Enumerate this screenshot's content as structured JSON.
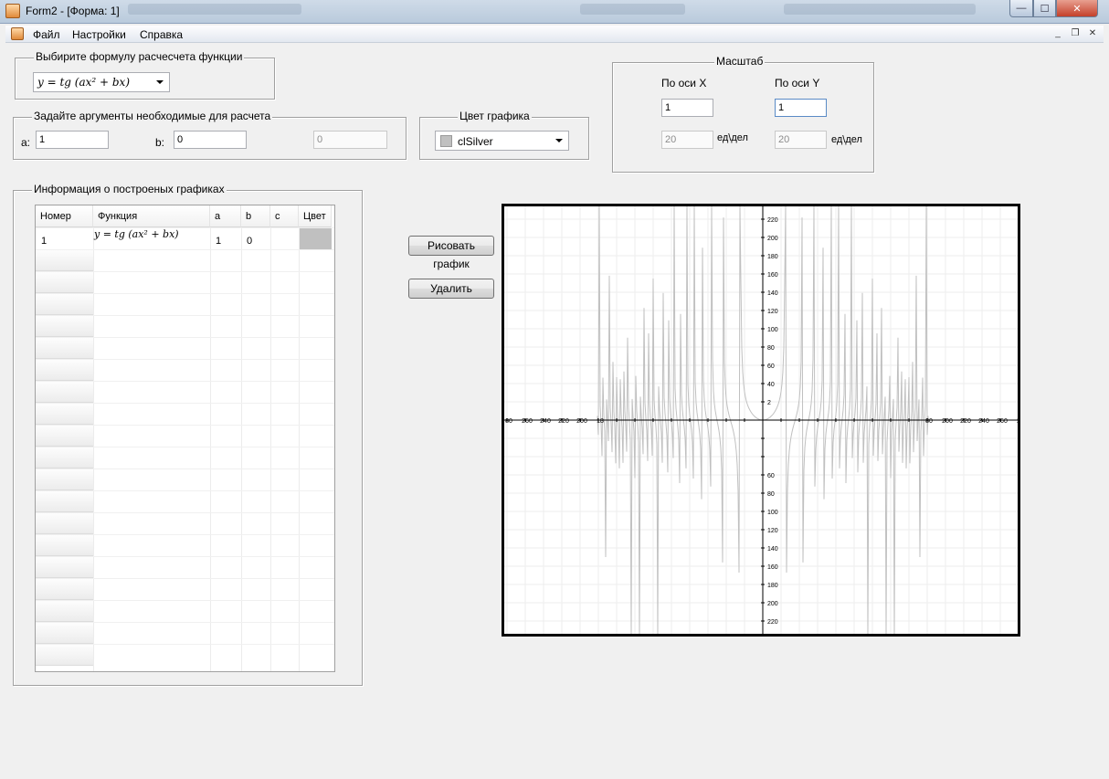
{
  "window": {
    "title": "Form2 - [Форма: 1]",
    "controls": {
      "minimize": "—",
      "maximize": "☐",
      "close": "✕"
    }
  },
  "menu": {
    "items": [
      "Файл",
      "Настройки",
      "Справка"
    ],
    "mdi_controls": {
      "minimize": "_",
      "restore": "❐",
      "close": "✕"
    }
  },
  "formula_group": {
    "title": "Выбирите формулу расчесчета функции",
    "selected": "y = tg (ax² + bx)"
  },
  "args_group": {
    "title": "Задайте аргументы необходимые для расчета",
    "a_label": "a:",
    "a_value": "1",
    "b_label": "b:",
    "b_value": "0",
    "c_value": "0"
  },
  "color_group": {
    "title": "Цвет графика",
    "selected": "clSilver",
    "swatch_color": "#c0c0c0"
  },
  "scale_group": {
    "title": "Масштаб",
    "x_label": "По оси X",
    "y_label": "По оси Y",
    "x_scale": "1",
    "y_scale": "1",
    "x_units": "20",
    "y_units": "20",
    "units_label_x": "ед\\дел",
    "units_label_y": "ед\\дел"
  },
  "info_group": {
    "title": "Информация о построеных графиках",
    "columns": [
      "Номер",
      "Функция",
      "a",
      "b",
      "c",
      "Цвет"
    ],
    "rows": [
      {
        "number": "1",
        "function": "y = tg (ax² + bx)",
        "a": "1",
        "b": "0",
        "c": "",
        "color": "#c0c0c0"
      }
    ]
  },
  "buttons": {
    "draw": "Рисовать график",
    "delete": "Удалить"
  },
  "graph": {
    "series_color": "#c0c0c0",
    "x_tick_labels_left": [
      "80",
      "260",
      "240",
      "220",
      "200",
      "18"
    ],
    "x_tick_labels_right": [
      "80",
      "200",
      "220",
      "240",
      "260",
      "28"
    ],
    "y_tick_labels_top": [
      "220",
      "200",
      "180",
      "160",
      "140",
      "120",
      "100",
      "80",
      "60",
      "40",
      "2"
    ],
    "y_tick_labels_bottom": [
      "60",
      "80",
      "100",
      "120",
      "140",
      "160",
      "180",
      "200",
      "220"
    ]
  }
}
